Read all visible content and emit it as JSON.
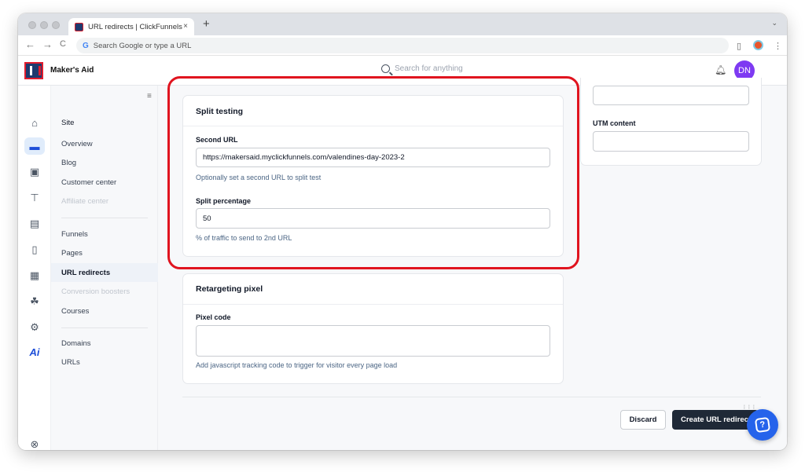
{
  "browser": {
    "tab_title": "URL redirects | ClickFunnels",
    "tab_close": "×",
    "new_tab": "+",
    "tab_menu": "⌄",
    "omnibox_text": "Search Google or type a URL",
    "back": "←",
    "forward": "→",
    "reload": "C",
    "google_glyph": "G",
    "side_panel": "▯",
    "kebab": "⋮"
  },
  "header": {
    "workspace": "Maker's Aid",
    "search_placeholder": "Search for anything",
    "bell": "🔔",
    "avatar_initials": "DN"
  },
  "rail": {
    "icons": [
      "home-icon",
      "website-icon",
      "store-icon",
      "cart-icon",
      "contacts-icon",
      "analytics-icon",
      "money-icon",
      "automation-icon",
      "settings-icon",
      "ai-icon",
      "help-icon"
    ],
    "ai_label": "Ai"
  },
  "subnav": {
    "site_header": "Site",
    "items_site": [
      "Overview",
      "Blog",
      "Customer center",
      "Affiliate center"
    ],
    "items_funnels": [
      "Funnels",
      "Pages",
      "URL redirects",
      "Conversion boosters",
      "Courses"
    ],
    "items_domains": [
      "Domains",
      "URLs"
    ],
    "active": "URL redirects"
  },
  "split_testing": {
    "title": "Split testing",
    "second_url_label": "Second URL",
    "second_url_value": "https://makersaid.myclickfunnels.com/valendines-day-2023-2",
    "second_url_help": "Optionally set a second URL to split test",
    "split_label": "Split percentage",
    "split_value": "50",
    "split_help": "% of traffic to send to 2nd URL"
  },
  "retargeting": {
    "title": "Retargeting pixel",
    "pixel_label": "Pixel code",
    "pixel_value": "",
    "pixel_help": "Add javascript tracking code to trigger for visitor every page load"
  },
  "utm": {
    "content_label": "UTM content",
    "content_value": ""
  },
  "actions": {
    "discard": "Discard",
    "create": "Create URL redirect"
  },
  "colors": {
    "highlight": "#e0141f",
    "primary_button": "#1f2937",
    "avatar": "#7e3af2",
    "help_bubble": "#2563eb"
  }
}
